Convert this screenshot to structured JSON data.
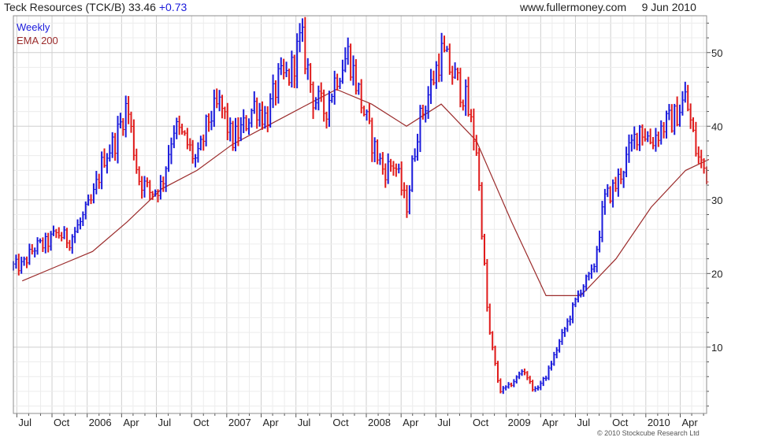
{
  "header": {
    "title": "Teck Resources (TCK/B)",
    "price": "33.46",
    "change": "+0.73",
    "site": "www.fullermoney.com",
    "date": "9 Jun 2010"
  },
  "legend": {
    "frequency": "Weekly",
    "indicator": "EMA 200"
  },
  "copyright": "© 2010 Stockcube Research Ltd",
  "colors": {
    "up": "#1a1adb",
    "down": "#e01b1b",
    "ema": "#9b2b2b",
    "grid": "#d4d4d4",
    "frame": "#8c8c8c"
  },
  "chart_data": {
    "type": "line",
    "chart_style": "weekly high-low bars, blue for up weeks, red for down weeks, with a 200-period EMA line",
    "y_ticks": [
      10,
      20,
      30,
      40,
      50
    ],
    "ylim": [
      1,
      55
    ],
    "y_axis_side": "right",
    "grid": true,
    "x_tick_labels": [
      "Jul",
      "Oct",
      "2006",
      "Apr",
      "Jul",
      "Oct",
      "2007",
      "Apr",
      "Jul",
      "Oct",
      "2008",
      "Apr",
      "Jul",
      "Oct",
      "2009",
      "Apr",
      "Jul",
      "Oct",
      "2010",
      "Apr"
    ],
    "price_series": {
      "name": "Weekly",
      "x": [
        "2005-07",
        "2005-08",
        "2005-09",
        "2005-10",
        "2005-11",
        "2005-12",
        "2006-01",
        "2006-02",
        "2006-03",
        "2006-04",
        "2006-05",
        "2006-06",
        "2006-07",
        "2006-08",
        "2006-09",
        "2006-10",
        "2006-11",
        "2006-12",
        "2007-01",
        "2007-02",
        "2007-03",
        "2007-04",
        "2007-05",
        "2007-06",
        "2007-07",
        "2007-08",
        "2007-09",
        "2007-10",
        "2007-11",
        "2007-12",
        "2008-01",
        "2008-02",
        "2008-03",
        "2008-04",
        "2008-05",
        "2008-06",
        "2008-07",
        "2008-08",
        "2008-09",
        "2008-10",
        "2008-11",
        "2008-12",
        "2009-01",
        "2009-02",
        "2009-03",
        "2009-04",
        "2009-05",
        "2009-06",
        "2009-07",
        "2009-08",
        "2009-09",
        "2009-10",
        "2009-11",
        "2009-12",
        "2010-01",
        "2010-02",
        "2010-03",
        "2010-04",
        "2010-05",
        "2010-06"
      ],
      "y": [
        21,
        23.5,
        24,
        25.5,
        24.5,
        27,
        30,
        36,
        38,
        43,
        33,
        31,
        32,
        40,
        38,
        35,
        41,
        43,
        38,
        40,
        43,
        41,
        46,
        47,
        52,
        44,
        42,
        47,
        50,
        44,
        38,
        34,
        35,
        29,
        40,
        45,
        50,
        47,
        44,
        37,
        13,
        4,
        5,
        7,
        4,
        6,
        10,
        14,
        18,
        20,
        30,
        32,
        36,
        40,
        38,
        40,
        41,
        44,
        36,
        33
      ]
    },
    "ema_series": {
      "name": "EMA 200",
      "x": [
        "2005-07",
        "2005-10",
        "2006-01",
        "2006-04",
        "2006-07",
        "2006-10",
        "2007-01",
        "2007-04",
        "2007-07",
        "2007-10",
        "2008-01",
        "2008-04",
        "2008-07",
        "2008-10",
        "2009-01",
        "2009-04",
        "2009-07",
        "2009-10",
        "2010-01",
        "2010-04",
        "2010-06"
      ],
      "y": [
        19,
        21,
        23,
        27,
        31.5,
        34,
        37.5,
        40,
        42.5,
        45,
        43,
        40,
        43,
        38,
        27,
        17,
        17,
        22,
        29,
        34,
        35.5
      ]
    }
  }
}
